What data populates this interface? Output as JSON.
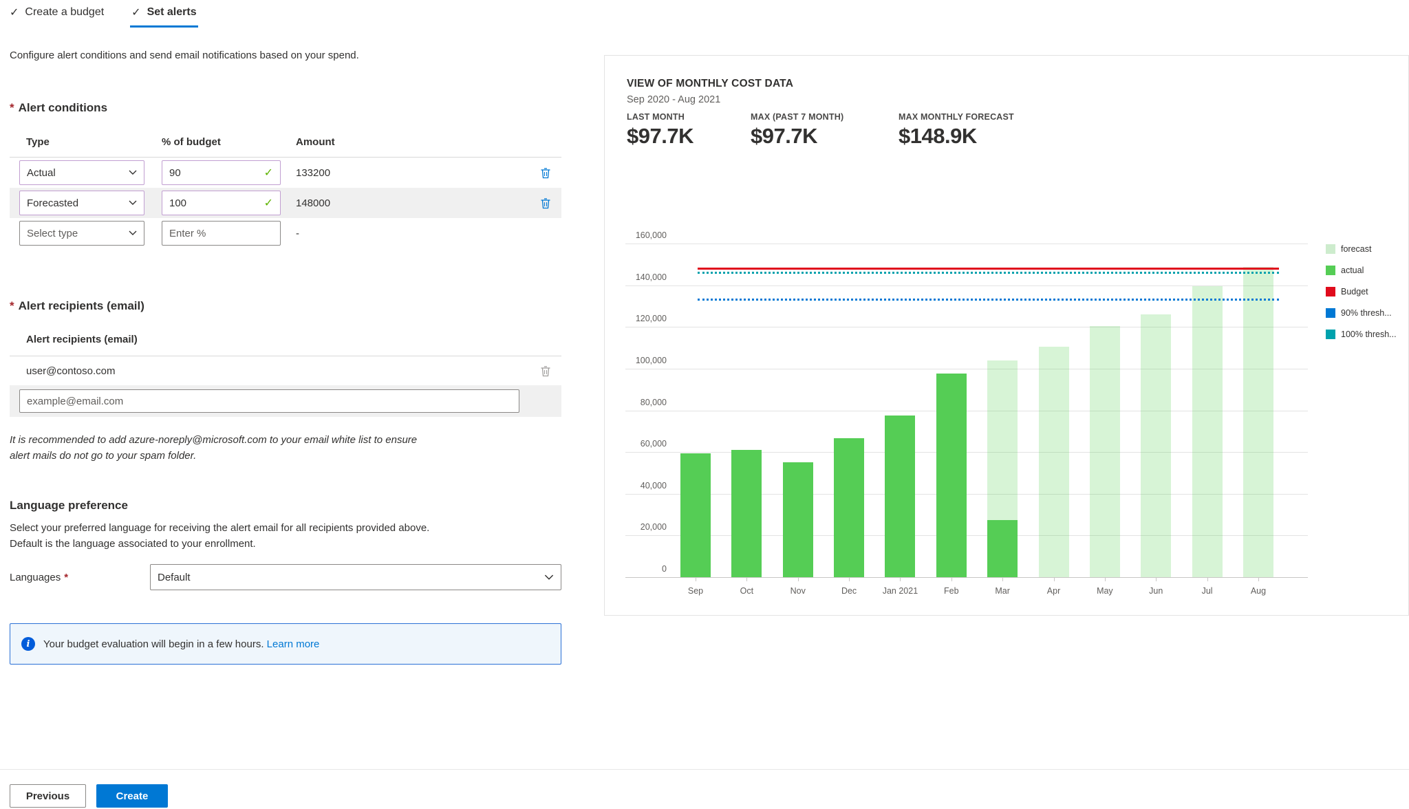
{
  "misc": {
    "required_mark": "*"
  },
  "tabs": [
    {
      "label": "Create a budget",
      "completed": true,
      "active": false
    },
    {
      "label": "Set alerts",
      "completed": true,
      "active": true
    }
  ],
  "intro": "Configure alert conditions and send email notifications based on your spend.",
  "alert_conditions": {
    "heading": "Alert conditions",
    "columns": [
      "Type",
      "% of budget",
      "Amount"
    ],
    "rows": [
      {
        "type": "Actual",
        "percent": "90",
        "amount": "133200"
      },
      {
        "type": "Forecasted",
        "percent": "100",
        "amount": "148000"
      }
    ],
    "empty_row": {
      "type_placeholder": "Select type",
      "percent_placeholder": "Enter %",
      "amount": "-"
    }
  },
  "recipients": {
    "heading": "Alert recipients (email)",
    "column": "Alert recipients (email)",
    "emails": [
      "user@contoso.com"
    ],
    "input_placeholder": "example@email.com",
    "note": "It is recommended to add azure-noreply@microsoft.com to your email white list to ensure alert mails do not go to your spam folder."
  },
  "language": {
    "heading": "Language preference",
    "description": "Select your preferred language for receiving the alert email for all recipients provided above. Default is the language associated to your enrollment.",
    "label": "Languages",
    "value": "Default"
  },
  "banner": {
    "text": "Your budget evaluation will begin in a few hours.",
    "link": "Learn more"
  },
  "footer": {
    "previous": "Previous",
    "create": "Create"
  },
  "chart_panel": {
    "title": "VIEW OF MONTHLY COST DATA",
    "subtitle": "Sep 2020 - Aug 2021",
    "stats": [
      {
        "label": "LAST MONTH",
        "value": "$97.7K"
      },
      {
        "label": "MAX (PAST 7 MONTH)",
        "value": "$97.7K"
      },
      {
        "label": "MAX MONTHLY FORECAST",
        "value": "$148.9K"
      }
    ]
  },
  "chart_data": {
    "type": "bar",
    "title": "VIEW OF MONTHLY COST DATA",
    "subtitle": "Sep 2020 - Aug 2021",
    "categories": [
      "Sep",
      "Oct",
      "Nov",
      "Dec",
      "Jan 2021",
      "Feb",
      "Mar",
      "Apr",
      "May",
      "Jun",
      "Jul",
      "Aug"
    ],
    "series": [
      {
        "name": "actual",
        "color": "#55cd55",
        "values": [
          59500,
          61000,
          55000,
          66500,
          77500,
          97700,
          27500,
          null,
          null,
          null,
          null,
          null
        ]
      },
      {
        "name": "forecast",
        "color": "rgba(87,207,84,0.24)",
        "values": [
          null,
          null,
          null,
          null,
          null,
          null,
          104000,
          110500,
          120500,
          126000,
          139500,
          148900
        ]
      }
    ],
    "lines": [
      {
        "name": "Budget",
        "value": 148000,
        "color": "#e00b1c",
        "style": "solid"
      },
      {
        "name": "100% threshold",
        "value": 148000,
        "color": "#00a2ad",
        "style": "dotted"
      },
      {
        "name": "90% threshold",
        "value": 133200,
        "color": "#0078d4",
        "style": "dotted"
      }
    ],
    "ylim": [
      0,
      160000
    ],
    "yticks": [
      0,
      20000,
      40000,
      60000,
      80000,
      100000,
      120000,
      140000,
      160000
    ],
    "grid": true,
    "legend_position": "right",
    "legend": [
      {
        "label": "forecast",
        "color": "#cdeccd"
      },
      {
        "label": "actual",
        "color": "#55cd55"
      },
      {
        "label": "Budget",
        "color": "#e00b1c"
      },
      {
        "label": "90% thresh...",
        "color": "#0078d4"
      },
      {
        "label": "100% thresh...",
        "color": "#00a2ad"
      }
    ]
  }
}
